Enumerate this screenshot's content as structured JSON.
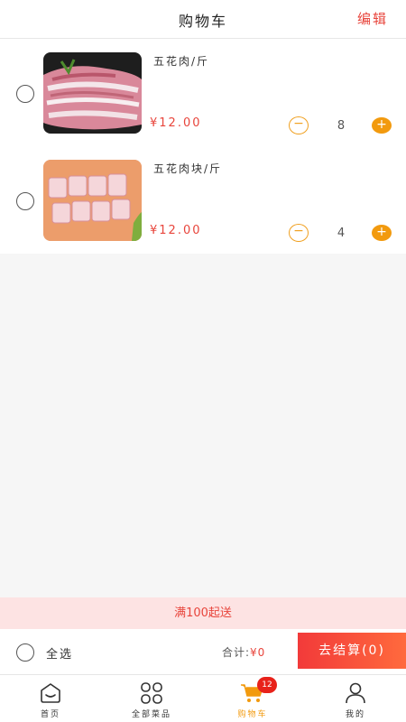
{
  "header": {
    "title": "购物车",
    "edit_label": "编辑"
  },
  "cart": {
    "items": [
      {
        "name": "五花肉/斤",
        "price": "¥12.00",
        "quantity": "8",
        "checked": false,
        "image_icon": "pork-belly-slices-image"
      },
      {
        "name": "五花肉块/斤",
        "price": "¥12.00",
        "quantity": "4",
        "checked": false,
        "image_icon": "pork-belly-cubes-image"
      }
    ],
    "minus_symbol": "−",
    "plus_symbol": "+"
  },
  "promo": {
    "text": "满100起送"
  },
  "checkout": {
    "select_all_label": "全选",
    "total_label": "合计:",
    "total_value": "¥0",
    "pay_button_label": "去结算(0)"
  },
  "tabbar": {
    "tabs": [
      {
        "label": "首页",
        "icon": "home-icon",
        "active": false
      },
      {
        "label": "全部菜品",
        "icon": "grid-icon",
        "active": false
      },
      {
        "label": "购物车",
        "icon": "cart-icon",
        "active": true,
        "badge": "12"
      },
      {
        "label": "我的",
        "icon": "user-icon",
        "active": false
      }
    ]
  },
  "colors": {
    "accent": "#f29a0e",
    "price_red": "#e8453c",
    "pay_gradient_start": "#f23a3a",
    "pay_gradient_end": "#ff6a3d",
    "promo_bg": "#fde3e3"
  }
}
